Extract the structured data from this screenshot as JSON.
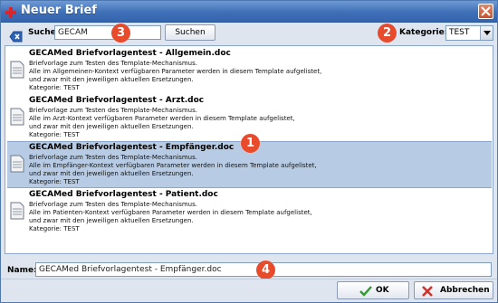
{
  "window": {
    "title": "Neuer Brief"
  },
  "search": {
    "label": "Suche:",
    "value": "GECAM",
    "button_label": "Suchen"
  },
  "category": {
    "label": "Kategorie:",
    "selected": "TEST"
  },
  "badges": [
    "1",
    "2",
    "3",
    "4"
  ],
  "templates": [
    {
      "title": "GECAMed Briefvorlagentest - Allgemein.doc",
      "lines": [
        "Briefvorlage zum Testen des Template-Mechanismus.",
        "Alle im Allgemeinen-Kontext verfügbaren Parameter werden in diesem Template aufgelistet,",
        "und zwar mit den jeweiligen aktuellen Ersetzungen.",
        "Kategorie: TEST"
      ],
      "selected": false
    },
    {
      "title": "GECAMed Briefvorlagentest - Arzt.doc",
      "lines": [
        "Briefvorlage zum Testen des Template-Mechanismus.",
        "Alle im Arzt-Kontext verfügbaren Parameter werden in diesem Template aufgelistet,",
        "und zwar mit den jeweiligen aktuellen Ersetzungen.",
        "Kategorie: TEST"
      ],
      "selected": false
    },
    {
      "title": "GECAMed Briefvorlagentest - Empfänger.doc",
      "lines": [
        "Briefvorlage zum Testen des Template-Mechanismus.",
        "Alle im Empfänger-Kontext verfügbaren Parameter werden in diesem Template aufgelistet,",
        "und zwar mit den jeweiligen aktuellen Ersetzungen.",
        "Kategorie: TEST"
      ],
      "selected": true
    },
    {
      "title": "GECAMed Briefvorlagentest - Patient.doc",
      "lines": [
        "Briefvorlage zum Testen des Template-Mechanismus.",
        "Alle im Patienten-Kontext verfügbaren Parameter werden in diesem Template aufgelistet,",
        "und zwar mit den jeweiligen aktuellen Ersetzungen.",
        "Kategorie: TEST"
      ],
      "selected": false
    }
  ],
  "name": {
    "label": "Name:",
    "value": "GECAMed Briefvorlagentest - Empfänger.doc"
  },
  "buttons": {
    "ok": "OK",
    "cancel": "Abbrechen"
  },
  "colors": {
    "title_bar": "#3f6fb6",
    "selection": "#b7cce4",
    "badge": "#e84a2c"
  },
  "icons": [
    "window-plus-icon",
    "close-icon",
    "clear-search-icon",
    "dropdown-arrow-icon",
    "document-icon",
    "checkmark-icon",
    "cross-icon"
  ]
}
